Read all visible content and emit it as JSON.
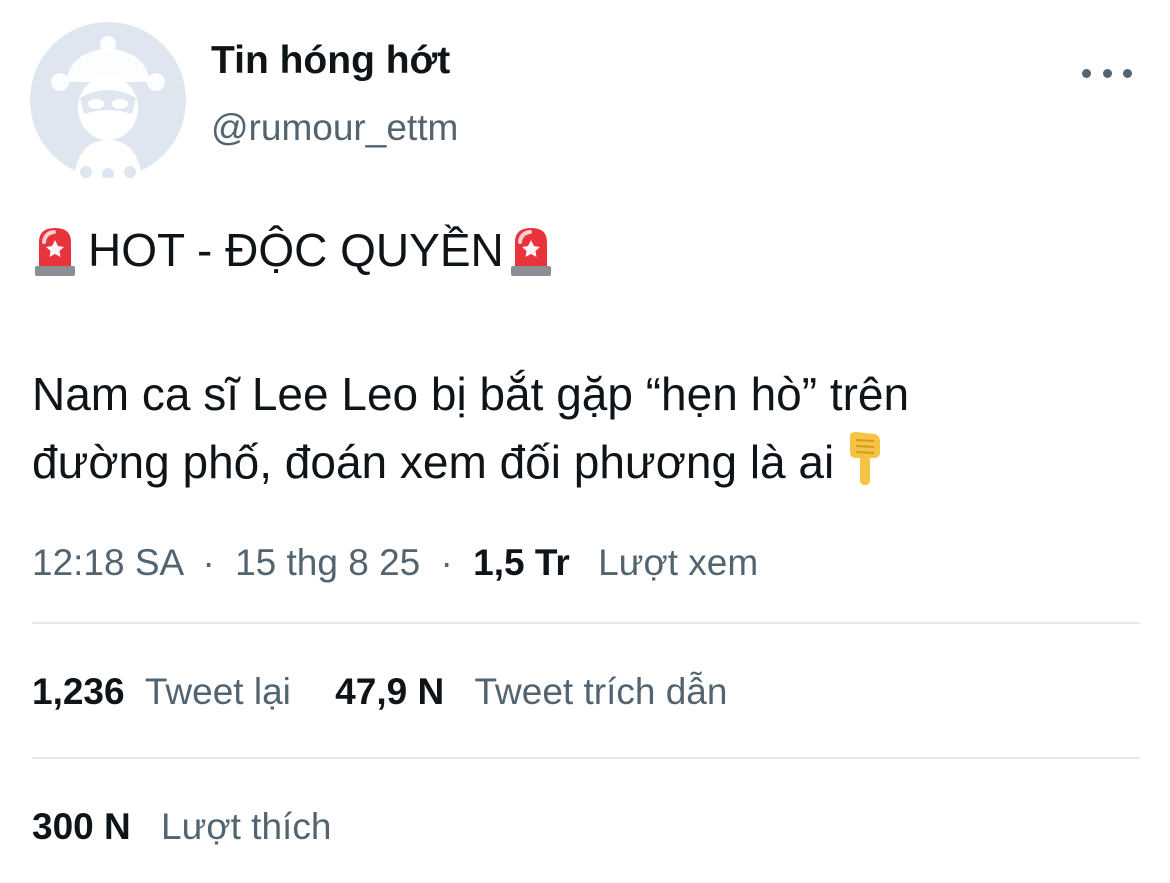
{
  "user": {
    "display_name": "Tin hóng hớt",
    "handle": "@rumour_ettm",
    "avatar_icon": "masked-face-avatar-icon"
  },
  "menu": {
    "more_icon": "more-options-icon"
  },
  "tweet": {
    "headline_icon": "police-siren-emoji",
    "headline": "HOT - ĐỘC QUYỀN",
    "lines": [
      "Nam ca sĩ Lee Leo bị bắt gặp “hẹn hò” trên",
      "đường phố, đoán xem đối phương là ai"
    ],
    "trailing_icon": "pointing-down-hand-emoji"
  },
  "meta": {
    "time": "12:18 SA",
    "separator": "·",
    "date": "15 thg 8 25",
    "views_count": "1,5 Tr",
    "views_label": "Lượt xem"
  },
  "stats": {
    "retweets_count": "1,236",
    "retweets_label": "Tweet lại",
    "quotes_count": "47,9 N",
    "quotes_label": "Tweet trích dẫn",
    "likes_count": "300 N",
    "likes_label": "Lượt thích"
  },
  "colors": {
    "primary_text": "#0f1419",
    "secondary_text": "#536471",
    "divider": "#e6e9eb",
    "avatar_bg": "#dfe6ef"
  }
}
